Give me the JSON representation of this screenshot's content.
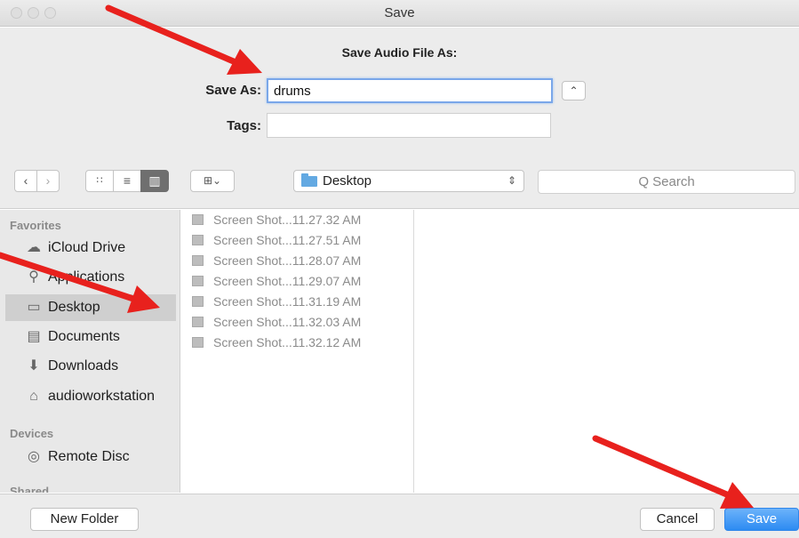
{
  "window": {
    "title": "Save"
  },
  "form": {
    "heading": "Save Audio File As:",
    "save_as_label": "Save As:",
    "save_as_value": "drums",
    "tags_label": "Tags:",
    "tags_value": "",
    "expand_icon": "chevron-up-icon"
  },
  "toolbar": {
    "back_glyph": "‹",
    "forward_glyph": "›",
    "view_icons": "∷",
    "view_list": "≡",
    "view_columns": "▥",
    "arrange_glyph": "⊞⌄",
    "location": "Desktop",
    "search_placeholder": "Q Search"
  },
  "sidebar": {
    "favorites_label": "Favorites",
    "items": [
      {
        "label": "iCloud Drive",
        "icon": "cloud-icon",
        "glyph": "☁"
      },
      {
        "label": "Applications",
        "icon": "applications-icon",
        "glyph": "⚲"
      },
      {
        "label": "Desktop",
        "icon": "desktop-icon",
        "glyph": "▭",
        "selected": true
      },
      {
        "label": "Documents",
        "icon": "documents-icon",
        "glyph": "▤"
      },
      {
        "label": "Downloads",
        "icon": "downloads-icon",
        "glyph": "⬇"
      },
      {
        "label": "audioworkstation",
        "icon": "home-icon",
        "glyph": "⌂"
      }
    ],
    "devices_label": "Devices",
    "devices": [
      {
        "label": "Remote Disc",
        "icon": "disc-icon",
        "glyph": "◎"
      }
    ],
    "shared_label": "Shared"
  },
  "files": [
    "Screen Shot...11.27.32 AM",
    "Screen Shot...11.27.51 AM",
    "Screen Shot...11.28.07 AM",
    "Screen Shot...11.29.07 AM",
    "Screen Shot...11.31.19 AM",
    "Screen Shot...11.32.03 AM",
    "Screen Shot...11.32.12 AM"
  ],
  "buttons": {
    "new_folder": "New Folder",
    "cancel": "Cancel",
    "save": "Save"
  },
  "colors": {
    "annotation_arrow": "#e8211d",
    "accent": "#2d8bf2",
    "folder": "#63a9e2"
  }
}
